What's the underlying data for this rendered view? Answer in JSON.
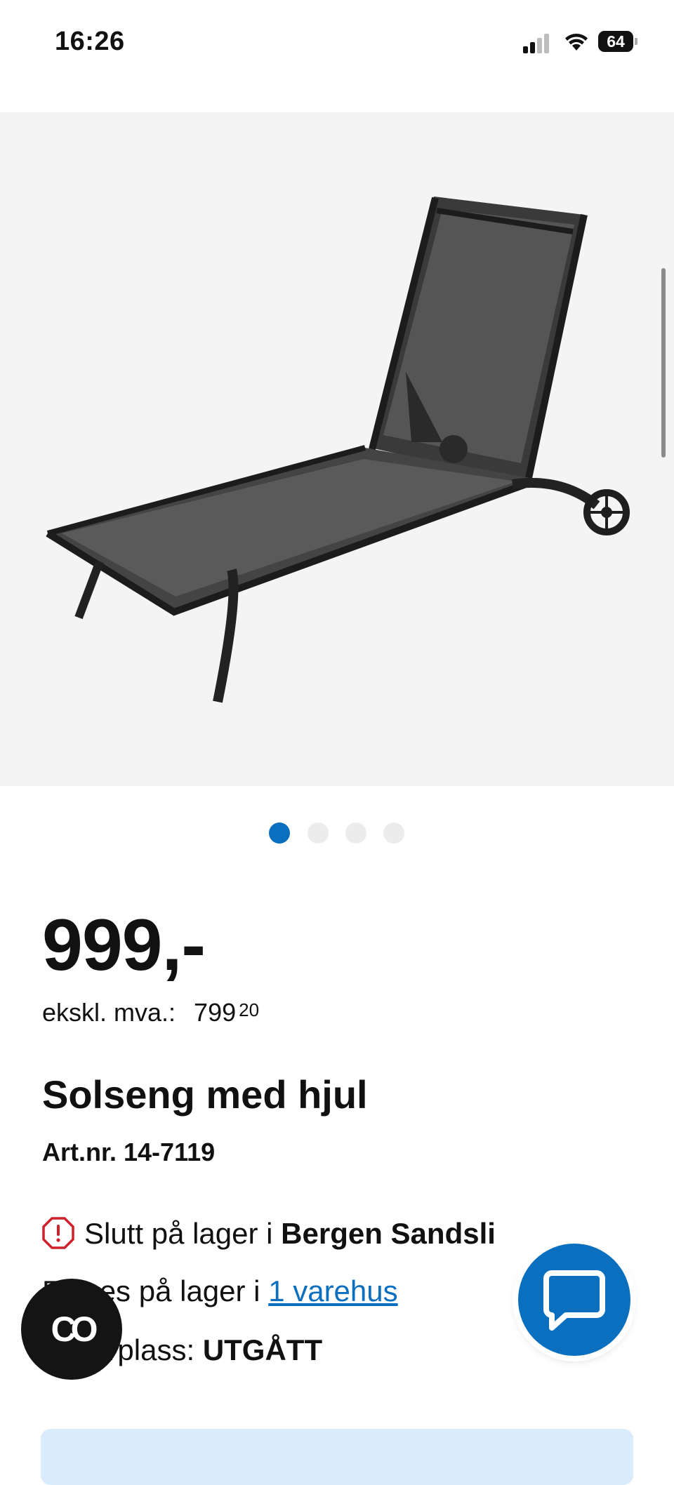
{
  "status_bar": {
    "time": "16:26",
    "battery": "64",
    "icons": [
      "cellular-signal-icon",
      "wifi-icon",
      "battery-icon"
    ]
  },
  "gallery": {
    "image": "sun-lounger-with-wheels-photo",
    "dots_total": 4,
    "active_dot": 1
  },
  "product": {
    "price": "999,-",
    "price_ex_vat_label": "ekskl. mva.:",
    "price_ex_vat_main": "799",
    "price_ex_vat_cents": "20",
    "title": "Solseng med hjul",
    "article_number": "Art.nr. 14-7119"
  },
  "stock": {
    "line1_prefix": "Slutt på lager i ",
    "line1_store": "Bergen Sandsli",
    "line2_prefix": "Finnes på lager i ",
    "line2_link": "1 varehus",
    "line3_prefix": "Lagerplass: ",
    "line3_value": "UTGÅTT"
  },
  "floating": {
    "chat_button": "chat-bubble-icon",
    "co_button_label": "CO"
  },
  "colors": {
    "accent": "#0a6fbf",
    "warning": "#d0202a",
    "banner": "#d9ecfb"
  }
}
